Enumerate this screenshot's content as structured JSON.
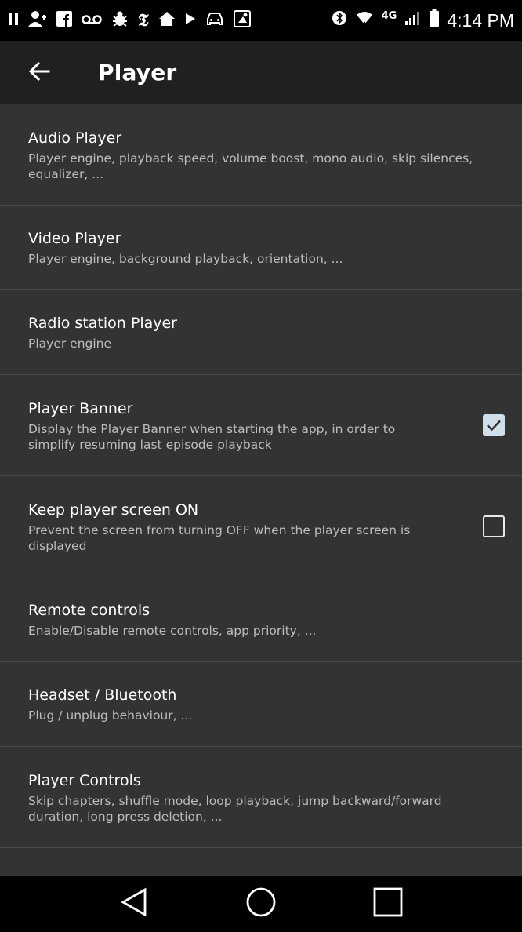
{
  "status_bar": {
    "time": "4:14 PM",
    "network": "4G",
    "left_icons": [
      "pause-icon",
      "add-person-icon",
      "facebook-icon",
      "voicemail-icon",
      "bug-icon",
      "nytimes-icon",
      "home-icon",
      "play-icon",
      "car-icon",
      "maps-icon"
    ],
    "right_icons": [
      "bluetooth-icon",
      "wifi-icon",
      "network-4g-icon",
      "signal-icon",
      "battery-icon"
    ]
  },
  "app_bar": {
    "title": "Player",
    "back_icon": "arrow-left-icon"
  },
  "settings": {
    "items": [
      {
        "title": "Audio Player",
        "subtitle": "Player engine, playback speed, volume boost, mono audio, skip silences, equalizer, ..."
      },
      {
        "title": "Video Player",
        "subtitle": "Player engine, background playback, orientation, ..."
      },
      {
        "title": "Radio station Player",
        "subtitle": "Player engine"
      },
      {
        "title": "Player Banner",
        "subtitle": "Display the Player Banner when starting the app, in order to simplify resuming last episode playback",
        "checked": true
      },
      {
        "title": "Keep player screen ON",
        "subtitle": "Prevent the screen from turning OFF when the player screen is displayed",
        "checked": false
      },
      {
        "title": "Remote controls",
        "subtitle": "Enable/Disable remote controls, app priority, ..."
      },
      {
        "title": "Headset / Bluetooth",
        "subtitle": "Plug / unplug behaviour, ..."
      },
      {
        "title": "Player Controls",
        "subtitle": "Skip chapters, shuffle mode, loop playback, jump backward/forward duration, long press deletion, ..."
      }
    ]
  },
  "nav_bar": {
    "icons": [
      "back-triangle-icon",
      "home-circle-icon",
      "recents-square-icon"
    ]
  },
  "colors": {
    "background": "#333333",
    "app_bar": "#202020",
    "status_bar": "#000000",
    "checkbox_checked": "#cfe0ea",
    "subtitle_text": "#bdbdbd"
  }
}
